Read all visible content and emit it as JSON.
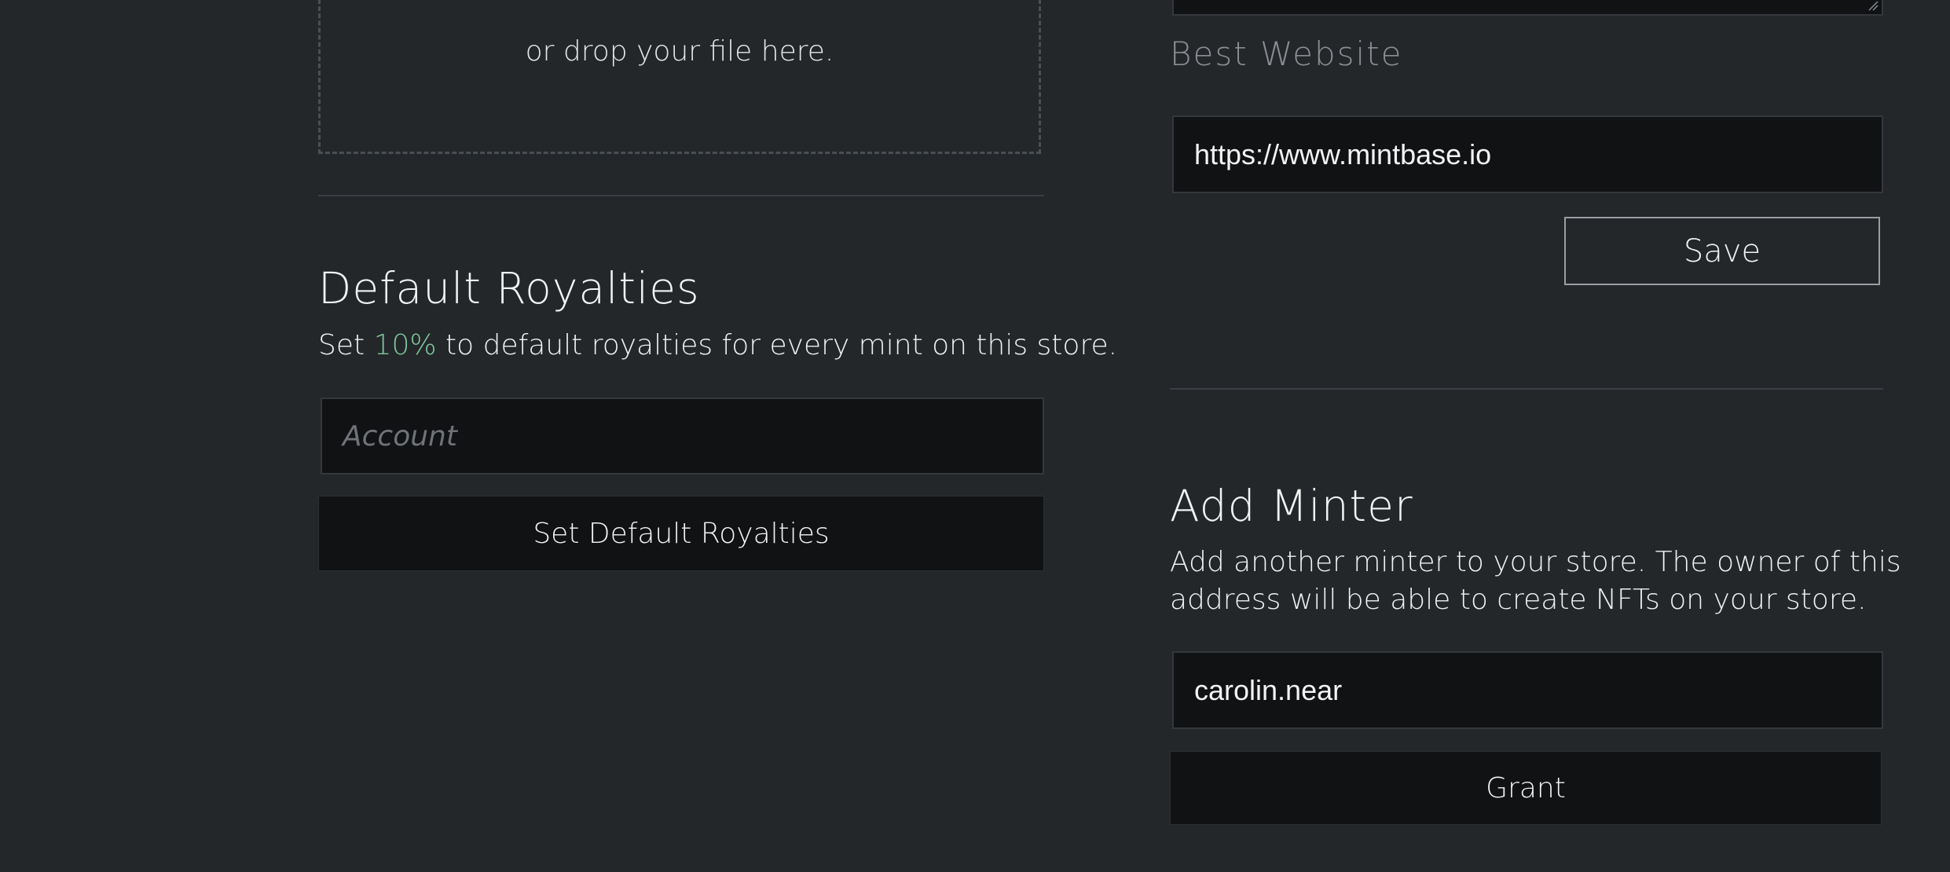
{
  "upload": {
    "drop_text": "or drop your file here."
  },
  "royalties": {
    "title": "Default Royalties",
    "desc_prefix": "Set ",
    "percent": "10%",
    "desc_suffix": " to default royalties for every mint on this store.",
    "account_placeholder": "Account",
    "button_label": "Set Default Royalties"
  },
  "website": {
    "label": "Best Website",
    "value": "https://www.mintbase.io",
    "save_label": "Save"
  },
  "minter": {
    "title": "Add Minter",
    "desc_line1": "Add another minter to your store. The owner of this",
    "desc_line2": "address will be able to create NFTs on your store.",
    "value": "carolin.near",
    "button_label": "Grant"
  },
  "colors": {
    "background": "#23272a",
    "input_background": "#111214",
    "accent": "#7fc79b"
  }
}
